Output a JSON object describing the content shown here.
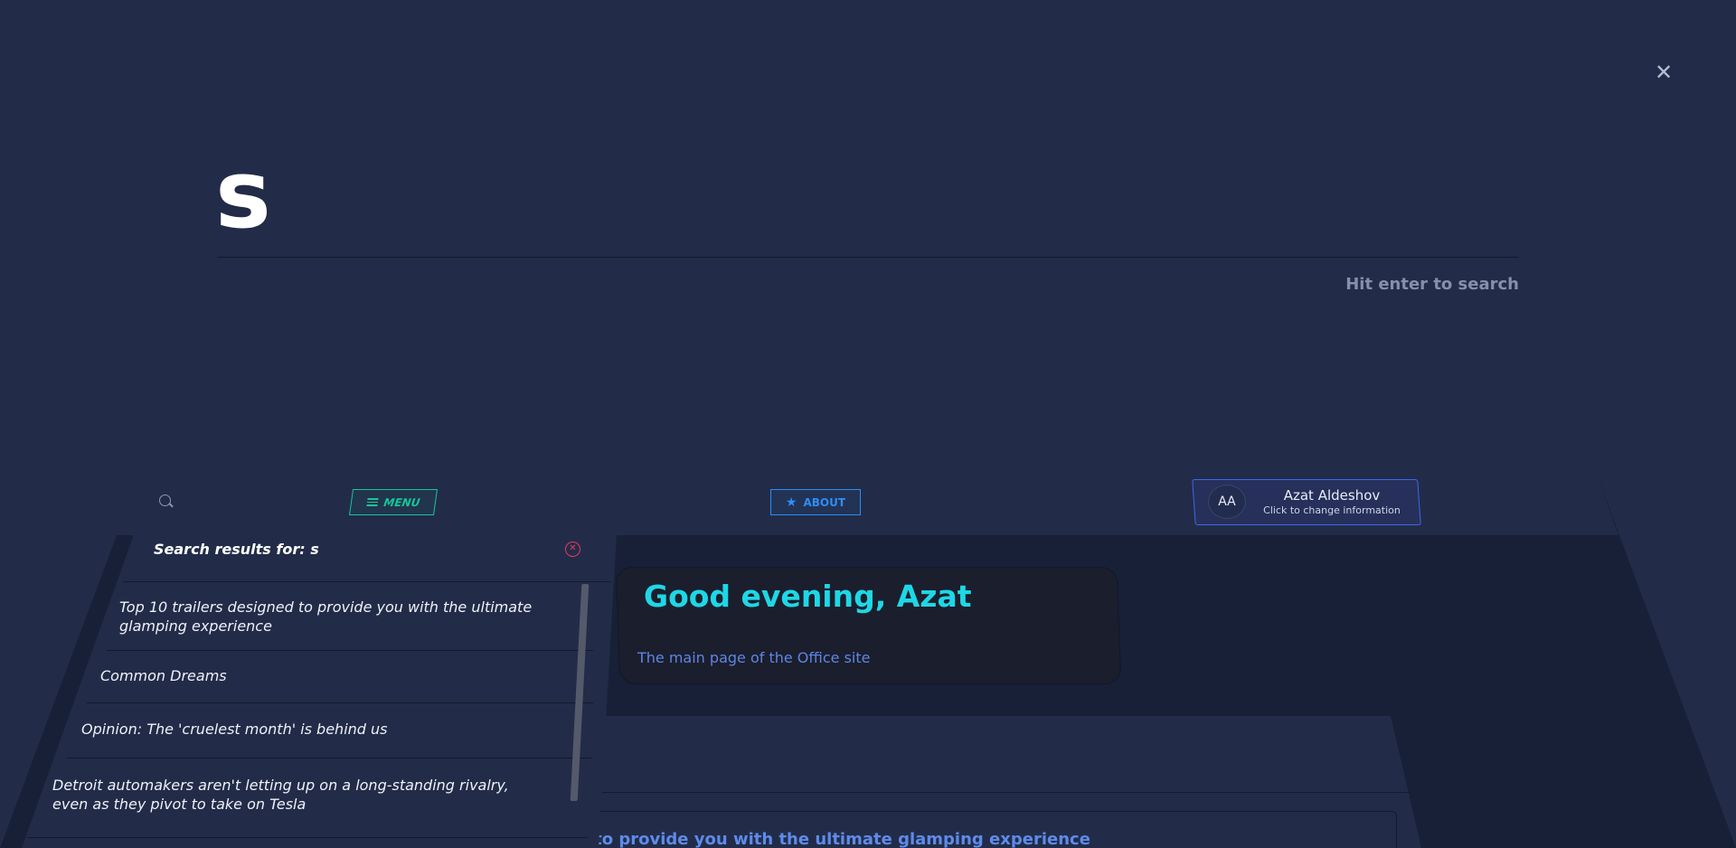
{
  "search": {
    "query": "s",
    "hint": "Hit enter to search",
    "close_icon": "close-icon"
  },
  "header": {
    "search_icon": "search-icon",
    "menu_label": "MENU",
    "about_label": "ABOUT",
    "user": {
      "initials": "AA",
      "name": "Azat Aldeshov",
      "subtitle": "Click to change information"
    }
  },
  "results": {
    "heading": "Search results for: s",
    "items": [
      {
        "title": "Top 10 trailers designed to provide you with the ultimate glamping experience"
      },
      {
        "title": "Common Dreams"
      },
      {
        "title": "Opinion: The 'cruelest month' is behind us"
      },
      {
        "title": "Detroit automakers aren't letting up on a long-standing rivalry, even as they pivot to take on Tesla"
      }
    ]
  },
  "greeting": {
    "title": "Good evening, Azat",
    "subtitle": "The main page of the Office site"
  },
  "band_card": {
    "text": "d to provide you with the ultimate glamping experience"
  },
  "colors": {
    "background": "#222c48",
    "accent_green": "#17c59a",
    "accent_blue": "#2d8ef5",
    "accent_cyan": "#1ed7e6",
    "danger": "#e8395e"
  }
}
